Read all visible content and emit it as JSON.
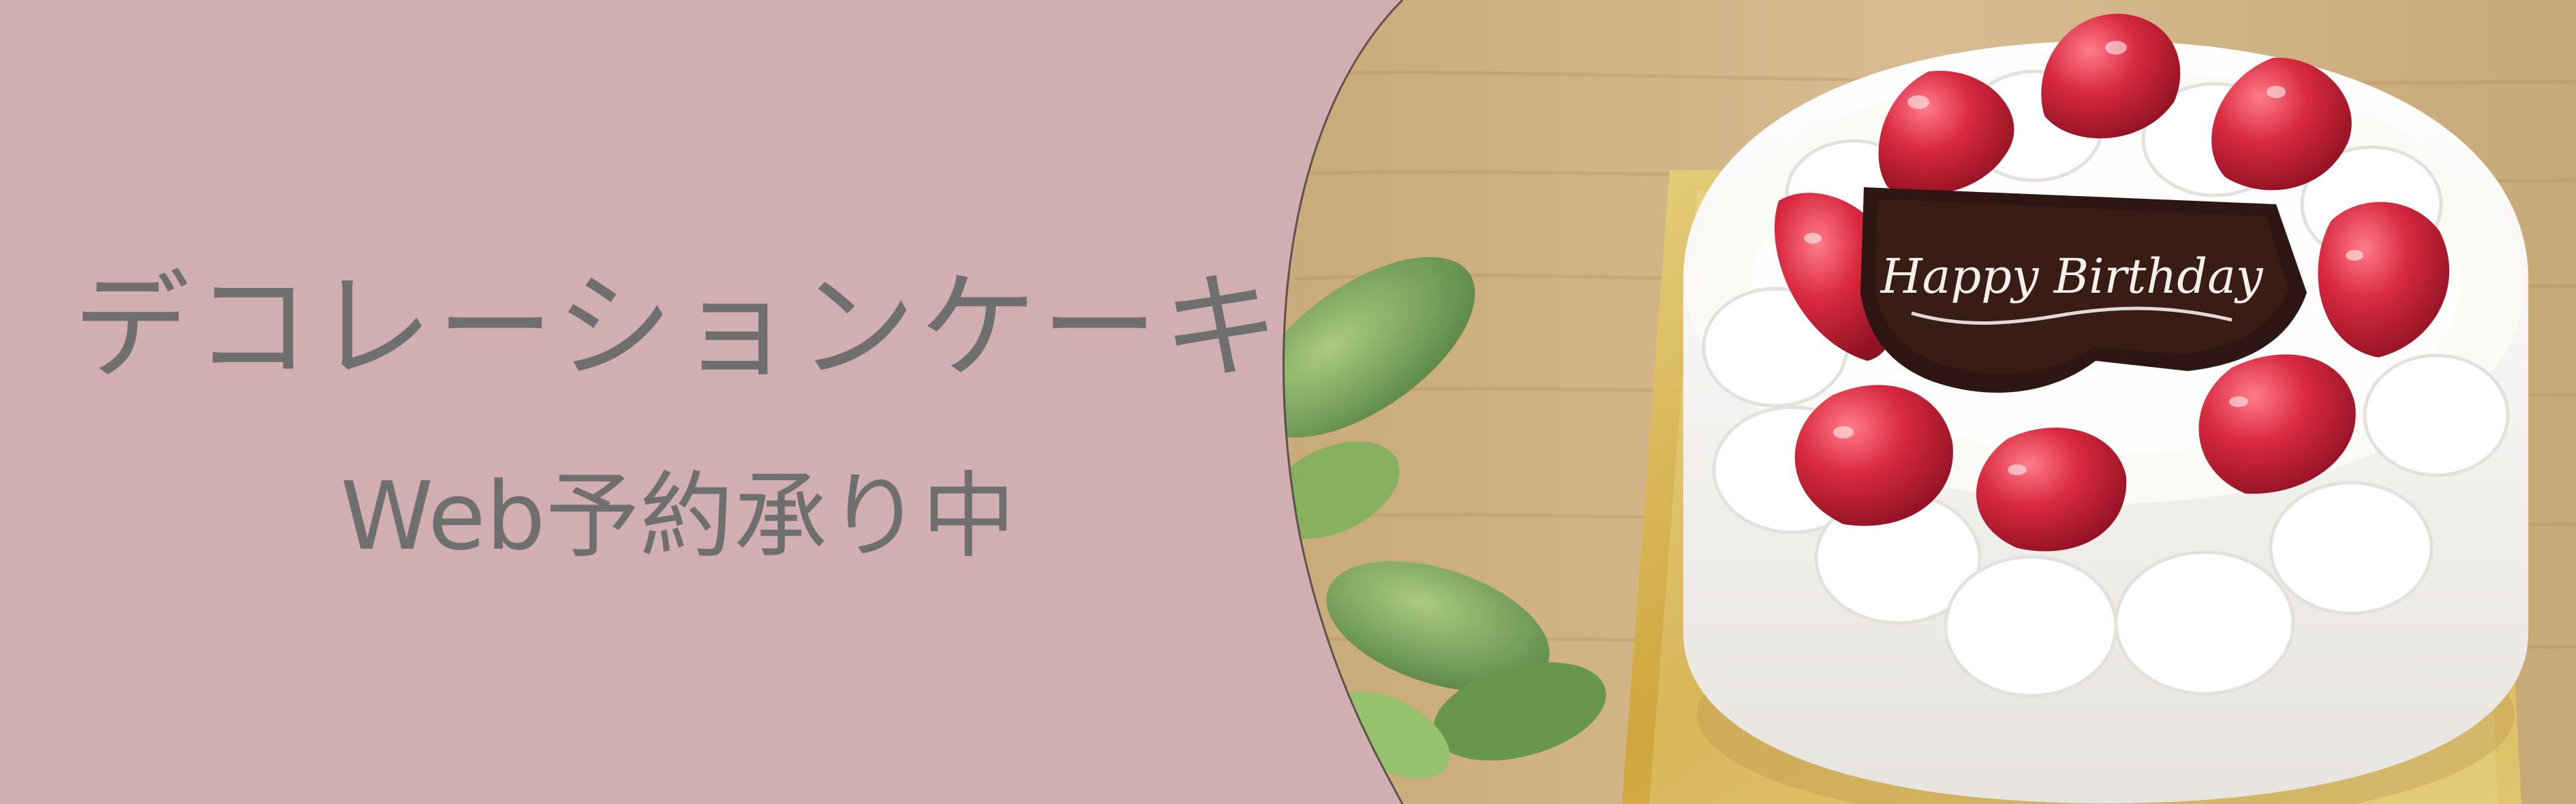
{
  "banner": {
    "title": "デコレーションケーキ",
    "subtitle": "Web予約承り中",
    "plaque_text": "Happy Birthday"
  },
  "colors": {
    "panel": "#d0aeb1",
    "text": "#6f6f6f",
    "wood": "#d1b487",
    "cream": "#f7f5f2",
    "strawberry": "#c7263a",
    "board": "#d4b24a"
  },
  "icons": {
    "plaque": "chocolate-plaque"
  }
}
